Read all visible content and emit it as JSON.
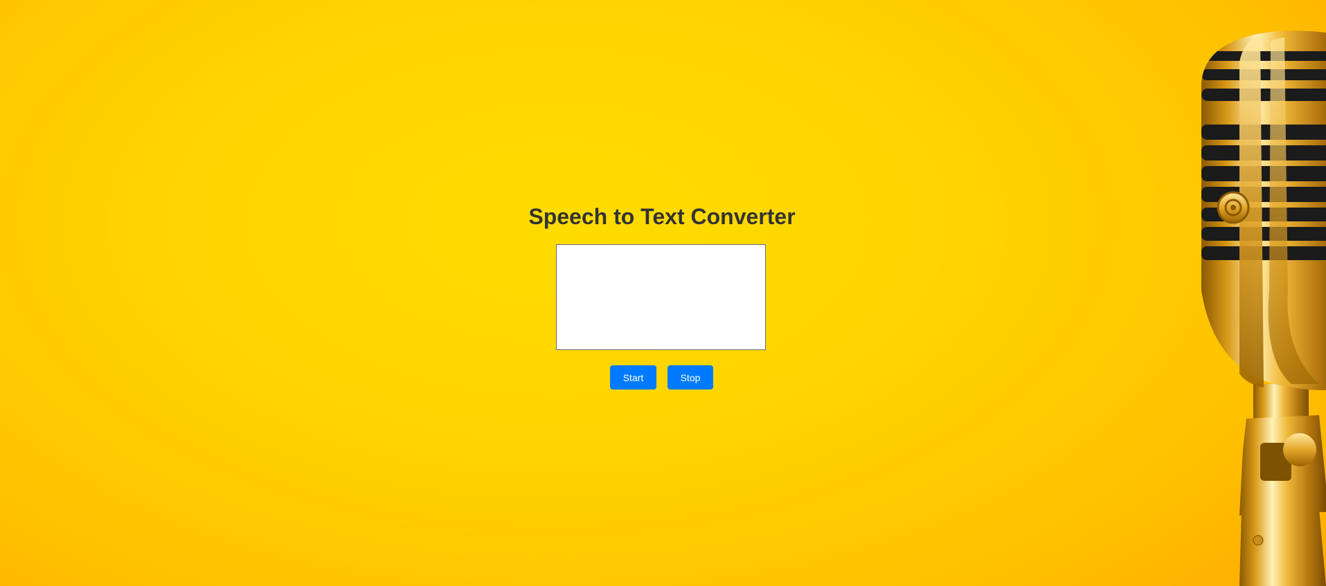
{
  "page": {
    "title": "Speech to Text Converter",
    "background_image": "golden-microphone"
  },
  "transcript": {
    "value": ""
  },
  "controls": {
    "start_label": "Start",
    "stop_label": "Stop"
  },
  "colors": {
    "background": "#ffd400",
    "button": "#007bff",
    "button_text": "#ffffff",
    "title": "#333333"
  }
}
